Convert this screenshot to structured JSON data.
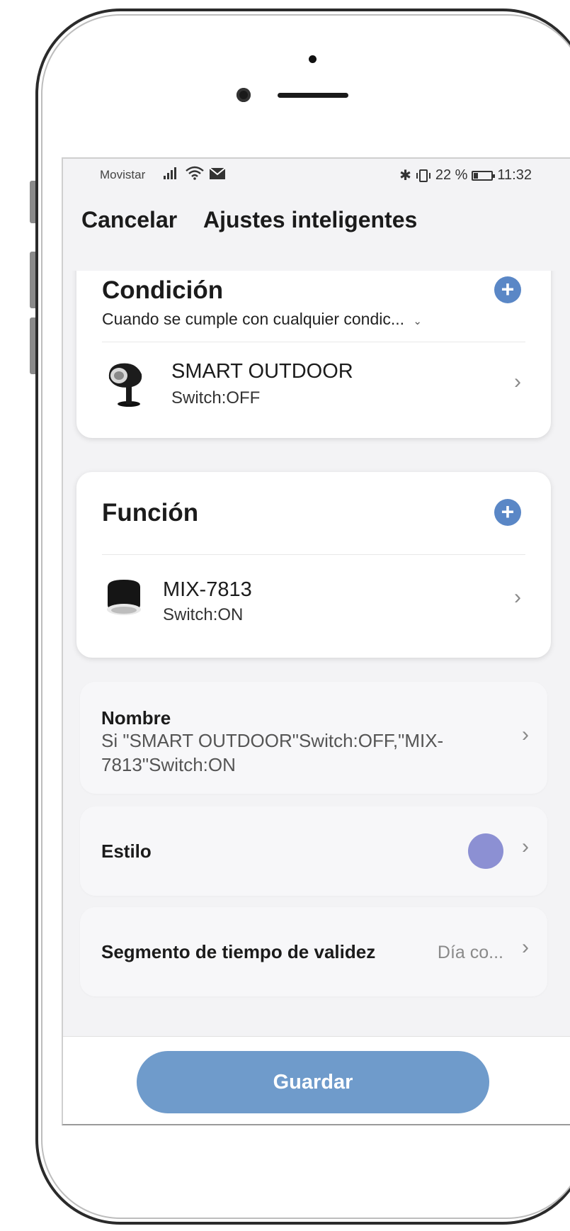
{
  "status_bar": {
    "carrier": "Movistar",
    "battery_text": "22 %",
    "battery_level": 0.22,
    "time": "11:32"
  },
  "header": {
    "cancel_label": "Cancelar",
    "title": "Ajustes inteligentes"
  },
  "condition": {
    "title": "Condición",
    "mode": "Cuando se cumple con cualquier condic...",
    "devices": [
      {
        "name": "SMART OUTDOOR",
        "state": "Switch:OFF",
        "icon": "spotlight-icon"
      }
    ]
  },
  "function": {
    "title": "Función",
    "devices": [
      {
        "name": "MIX-7813",
        "state": "Switch:ON",
        "icon": "downlight-icon"
      }
    ]
  },
  "settings": {
    "name_label": "Nombre",
    "name_value": "Si \"SMART OUTDOOR\"Switch:OFF,\"MIX-7813\"Switch:ON",
    "style_label": "Estilo",
    "style_color": "#8c90d3",
    "validity_label": "Segmento de tiempo de validez",
    "validity_value": "Día co..."
  },
  "footer": {
    "save_label": "Guardar"
  },
  "colors": {
    "accent": "#5a87c6",
    "save_button": "#6f9bcb"
  }
}
